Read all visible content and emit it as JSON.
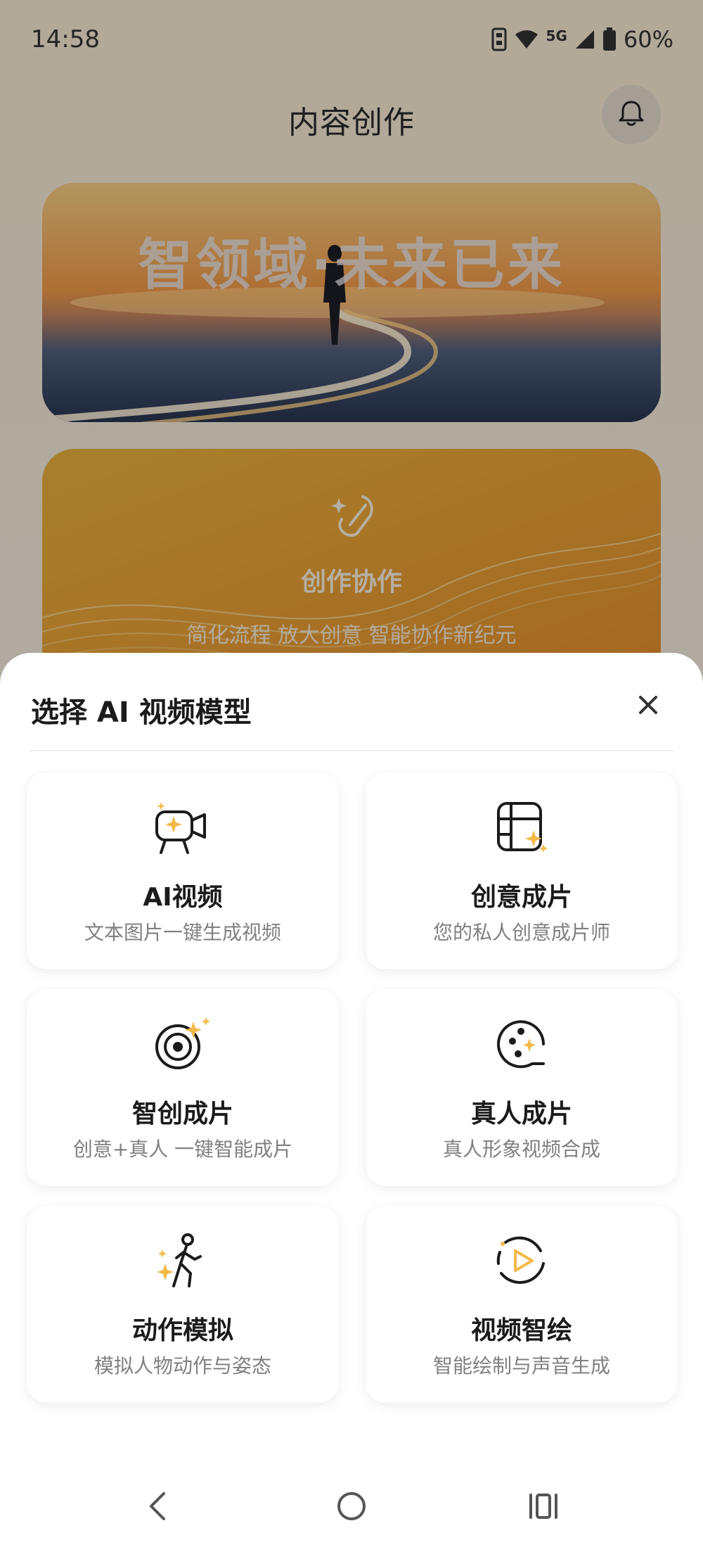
{
  "status_bar": {
    "time": "14:58",
    "network": "5G",
    "battery": "60%"
  },
  "page": {
    "title": "内容创作",
    "banner_text": "智领域·未来已来",
    "collab_title": "创作协作",
    "collab_subtitle": "简化流程 放大创意 智能协作新纪元"
  },
  "sheet": {
    "title": "选择 AI 视频模型",
    "items": [
      {
        "title": "AI视频",
        "subtitle": "文本图片一键生成视频",
        "icon": "video-camera-sparkle-icon"
      },
      {
        "title": "创意成片",
        "subtitle": "您的私人创意成片师",
        "icon": "film-sparkle-icon"
      },
      {
        "title": "智创成片",
        "subtitle": "创意+真人 一键智能成片",
        "icon": "target-sparkle-icon"
      },
      {
        "title": "真人成片",
        "subtitle": "真人形象视频合成",
        "icon": "reel-sparkle-icon"
      },
      {
        "title": "动作模拟",
        "subtitle": "模拟人物动作与姿态",
        "icon": "running-person-sparkle-icon"
      },
      {
        "title": "视频智绘",
        "subtitle": "智能绘制与声音生成",
        "icon": "play-circle-icon"
      }
    ]
  },
  "colors": {
    "accent": "#f5b94a",
    "icon_stroke": "#1b1b1b",
    "sheet_bg": "#ffffff"
  }
}
